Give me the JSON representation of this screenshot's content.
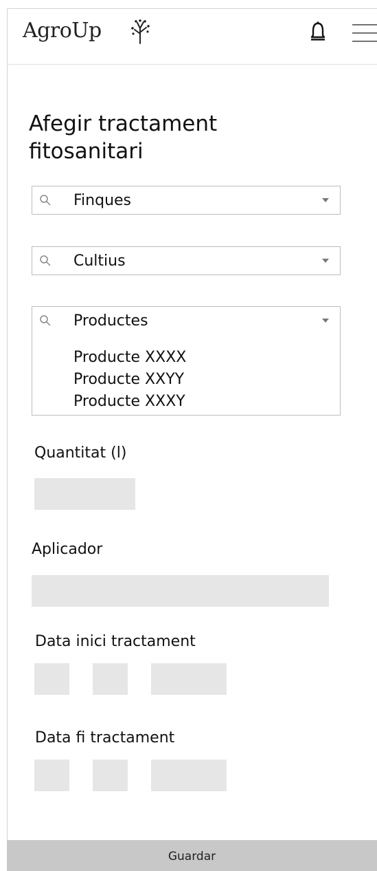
{
  "header": {
    "brand": "AgroUp",
    "icons": {
      "logo": "tree-sprout-icon",
      "notifications": "bell-icon",
      "menu": "hamburger-menu-icon"
    }
  },
  "page": {
    "title": "Afegir tractament fitosanitari"
  },
  "filters": {
    "finques": {
      "label": "Finques",
      "icon": "search-icon"
    },
    "cultius": {
      "label": "Cultius",
      "icon": "search-icon"
    },
    "productes": {
      "label": "Productes",
      "icon": "search-icon",
      "options": [
        "Producte XXXX",
        "Producte XXYY",
        "Producte XXXY"
      ]
    }
  },
  "form": {
    "quantity_label": "Quantitat (l)",
    "applicator_label": "Aplicador",
    "start_date_label": "Data inici tractament",
    "end_date_label": "Data fi tractament"
  },
  "actions": {
    "save_label": "Guardar"
  },
  "colors": {
    "field_fill": "#e6e6e6",
    "save_bar": "#c8c8c8",
    "border": "#bdbdbd"
  }
}
